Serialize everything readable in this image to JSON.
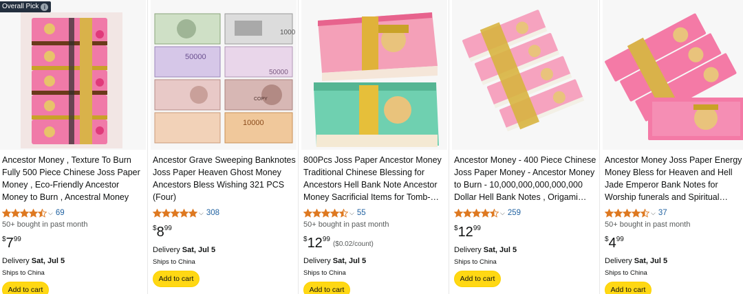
{
  "badge": {
    "label": "Overall Pick",
    "info_icon": "i"
  },
  "rating_chevron": "⌵",
  "colors": {
    "star": "#de7921",
    "link": "#2162a1",
    "button": "#ffd814"
  },
  "products": [
    {
      "title": "Ancestor Money , Texture To Burn Fully 500 Piece Chinese Joss Paper Money , Eco-Friendly Ancestor Money to Burn , Ancestral Money for…",
      "stars": 4.5,
      "rating_count": "69",
      "bought": "50+ bought in past month",
      "price_currency": "$",
      "price_whole": "7",
      "price_fraction": "99",
      "price_unit": "",
      "delivery_prefix": "Delivery ",
      "delivery_date": "Sat, Jul 5",
      "ships": "Ships to China",
      "cart_label": "Add to cart"
    },
    {
      "title": "Ancestor Grave Sweeping Banknotes Joss Paper Heaven Ghost Money Ancestors Bless Wishing 321 PCS (Four)",
      "stars": 5,
      "rating_count": "308",
      "bought": "",
      "price_currency": "$",
      "price_whole": "8",
      "price_fraction": "99",
      "price_unit": "",
      "delivery_prefix": "Delivery ",
      "delivery_date": "Sat, Jul 5",
      "ships": "Ships to China",
      "cart_label": "Add to cart",
      "image_text": {
        "b1": "1000",
        "b2": "50000",
        "b3": "50000",
        "b4": "10000",
        "b5": "COPY"
      }
    },
    {
      "title": "800Pcs Joss Paper Ancestor Money Traditional Chinese Blessing for Ancestors Hell Bank Note Ancestor Money Sacrificial Items for Tomb-…",
      "stars": 4.5,
      "rating_count": "55",
      "bought": "50+ bought in past month",
      "price_currency": "$",
      "price_whole": "12",
      "price_fraction": "99",
      "price_unit": "($0.02/count)",
      "delivery_prefix": "Delivery ",
      "delivery_date": "Sat, Jul 5",
      "ships": "Ships to China",
      "cart_label": "Add to cart"
    },
    {
      "title": "Ancestor Money - 400 Piece Chinese Joss Paper Money - Ancestor Money to Burn - 10,000,000,000,000,000 Dollar Hell Bank Notes ,  Origami…",
      "stars": 4.5,
      "rating_count": "259",
      "bought": "",
      "price_currency": "$",
      "price_whole": "12",
      "price_fraction": "99",
      "price_unit": "",
      "delivery_prefix": "Delivery ",
      "delivery_date": "Sat, Jul 5",
      "ships": "Ships to China",
      "cart_label": "Add to cart"
    },
    {
      "title": "Ancestor Money Joss Paper Energy Money Bless for Heaven and Hell Jade Emperor Bank Notes for Worship funerals and Spiritual…",
      "stars": 4.5,
      "rating_count": "37",
      "bought": "50+ bought in past month",
      "price_currency": "$",
      "price_whole": "4",
      "price_fraction": "99",
      "price_unit": "",
      "delivery_prefix": "Delivery ",
      "delivery_date": "Sat, Jul 5",
      "ships": "Ships to China",
      "cart_label": "Add to cart"
    }
  ]
}
